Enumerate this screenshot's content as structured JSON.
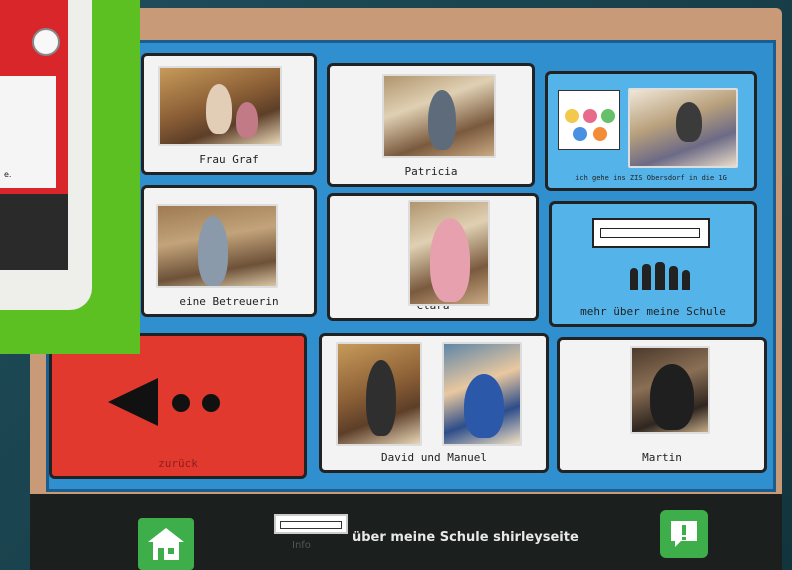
{
  "grid": {
    "cells": [
      {
        "label": "Frau Graf"
      },
      {
        "label": "Patricia"
      },
      {
        "label": "ich gehe ins ZIS Obersdorf in die 1G"
      },
      {
        "label": "eine Betreuerin"
      },
      {
        "label": "Clara"
      },
      {
        "label": "mehr über meine Schule"
      },
      {
        "label": "zurück"
      },
      {
        "label": "David und Manuel"
      },
      {
        "label": "Martin"
      }
    ]
  },
  "bottom_bar": {
    "title": "über meine Schule shirleyseite",
    "small_label": "Info"
  },
  "inset": {
    "text": "e."
  },
  "colors": {
    "grid_background": "#2f8fcf",
    "blue_tile": "#54b4ea",
    "red_tile": "#e2392f",
    "home_button": "#3eae4a"
  },
  "icons": {
    "back": "back-arrow-icon",
    "home": "home-icon",
    "alert": "alert-bubble-icon",
    "school_building": "school-building-icon",
    "people": "people-group-icon"
  }
}
